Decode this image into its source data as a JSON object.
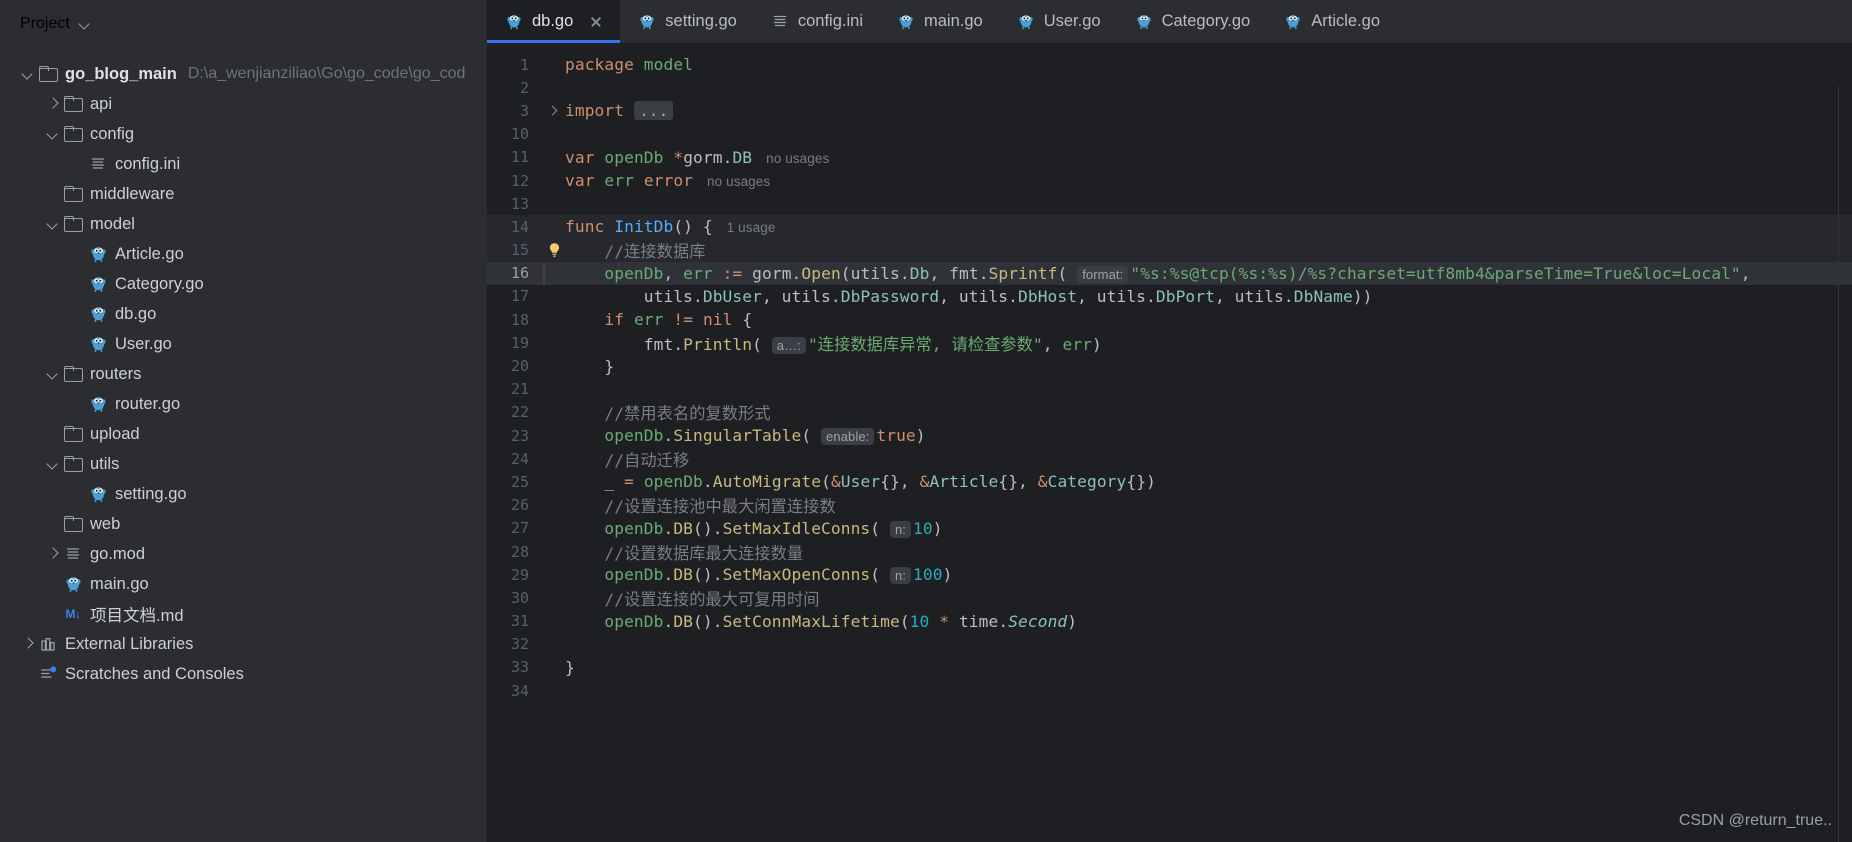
{
  "sidebar": {
    "header": {
      "title": "Project",
      "chevron_icon": "chevron-down-icon"
    },
    "tree": [
      {
        "indent": 0,
        "arrow": "down",
        "icon": "folder-icon",
        "label": "go_blog_main",
        "bold": true,
        "path": "D:\\a_wenjianziliao\\Go\\go_code\\go_cod"
      },
      {
        "indent": 1,
        "arrow": "right",
        "icon": "folder-icon",
        "label": "api"
      },
      {
        "indent": 1,
        "arrow": "down",
        "icon": "folder-icon",
        "label": "config"
      },
      {
        "indent": 2,
        "arrow": "none",
        "icon": "ini-file-icon",
        "label": "config.ini"
      },
      {
        "indent": 1,
        "arrow": "none",
        "icon": "folder-icon",
        "label": "middleware"
      },
      {
        "indent": 1,
        "arrow": "down",
        "icon": "folder-icon",
        "label": "model"
      },
      {
        "indent": 2,
        "arrow": "none",
        "icon": "go-file-icon",
        "label": "Article.go"
      },
      {
        "indent": 2,
        "arrow": "none",
        "icon": "go-file-icon",
        "label": "Category.go"
      },
      {
        "indent": 2,
        "arrow": "none",
        "icon": "go-file-icon",
        "label": "db.go"
      },
      {
        "indent": 2,
        "arrow": "none",
        "icon": "go-file-icon",
        "label": "User.go"
      },
      {
        "indent": 1,
        "arrow": "down",
        "icon": "folder-icon",
        "label": "routers"
      },
      {
        "indent": 2,
        "arrow": "none",
        "icon": "go-file-icon",
        "label": "router.go"
      },
      {
        "indent": 1,
        "arrow": "none",
        "icon": "folder-icon",
        "label": "upload"
      },
      {
        "indent": 1,
        "arrow": "down",
        "icon": "folder-icon",
        "label": "utils"
      },
      {
        "indent": 2,
        "arrow": "none",
        "icon": "go-file-icon",
        "label": "setting.go"
      },
      {
        "indent": 1,
        "arrow": "none",
        "icon": "folder-icon",
        "label": "web"
      },
      {
        "indent": 1,
        "arrow": "right",
        "icon": "modfile-icon",
        "label": "go.mod"
      },
      {
        "indent": 1,
        "arrow": "none",
        "icon": "go-file-icon",
        "label": "main.go"
      },
      {
        "indent": 1,
        "arrow": "none",
        "icon": "markdown-icon",
        "label": "项目文档.md"
      },
      {
        "indent": 0,
        "arrow": "right",
        "icon": "library-icon",
        "label": "External Libraries"
      },
      {
        "indent": 0,
        "arrow": "none",
        "icon": "scratch-icon",
        "label": "Scratches and Consoles"
      }
    ]
  },
  "tabs": [
    {
      "label": "db.go",
      "icon": "go-file-icon",
      "active": true,
      "closable": true
    },
    {
      "label": "setting.go",
      "icon": "go-file-icon",
      "active": false,
      "closable": false
    },
    {
      "label": "config.ini",
      "icon": "ini-file-icon",
      "active": false,
      "closable": false
    },
    {
      "label": "main.go",
      "icon": "go-file-icon",
      "active": false,
      "closable": false
    },
    {
      "label": "User.go",
      "icon": "go-file-icon",
      "active": false,
      "closable": false
    },
    {
      "label": "Category.go",
      "icon": "go-file-icon",
      "active": false,
      "closable": false
    },
    {
      "label": "Article.go",
      "icon": "go-file-icon",
      "active": false,
      "closable": false
    }
  ],
  "editor": {
    "language": "go",
    "line_numbers": [
      1,
      2,
      3,
      10,
      11,
      12,
      13,
      14,
      15,
      16,
      17,
      18,
      19,
      20,
      21,
      22,
      23,
      24,
      25,
      26,
      27,
      28,
      29,
      30,
      31,
      32,
      33,
      34
    ],
    "lines": [
      {
        "n": 1,
        "text": "package model"
      },
      {
        "n": 2,
        "text": ""
      },
      {
        "n": 3,
        "text": "import ...",
        "folded": true
      },
      {
        "n": 10,
        "text": ""
      },
      {
        "n": 11,
        "text": "var openDb *gorm.DB",
        "inlay": "no usages"
      },
      {
        "n": 12,
        "text": "var err error",
        "inlay": "no usages"
      },
      {
        "n": 13,
        "text": ""
      },
      {
        "n": 14,
        "text": "func InitDb() {",
        "inlay": "1 usage",
        "highlight": true
      },
      {
        "n": 15,
        "text": "    //连接数据库",
        "bulb": true,
        "highlight": true
      },
      {
        "n": 16,
        "text": "    openDb, err := gorm.Open(utils.Db, fmt.Sprintf( format: \"%s:%s@tcp(%s:%s)/%s?charset=utf8mb4&parseTime=True&loc=Local\",",
        "selected": true
      },
      {
        "n": 17,
        "text": "        utils.DbUser, utils.DbPassword, utils.DbHost, utils.DbPort, utils.DbName))"
      },
      {
        "n": 18,
        "text": "    if err != nil {"
      },
      {
        "n": 19,
        "text": "        fmt.Println( a…: \"连接数据库异常, 请检查参数\", err)"
      },
      {
        "n": 20,
        "text": "    }"
      },
      {
        "n": 21,
        "text": ""
      },
      {
        "n": 22,
        "text": "    //禁用表名的复数形式"
      },
      {
        "n": 23,
        "text": "    openDb.SingularTable( enable: true)"
      },
      {
        "n": 24,
        "text": "    //自动迁移"
      },
      {
        "n": 25,
        "text": "    _ = openDb.AutoMigrate(&User{}, &Article{}, &Category{})"
      },
      {
        "n": 26,
        "text": "    //设置连接池中最大闲置连接数"
      },
      {
        "n": 27,
        "text": "    openDb.DB().SetMaxIdleConns( n: 10)"
      },
      {
        "n": 28,
        "text": "    //设置数据库最大连接数量"
      },
      {
        "n": 29,
        "text": "    openDb.DB().SetMaxOpenConns( n: 100)"
      },
      {
        "n": 30,
        "text": "    //设置连接的最大可复用时间"
      },
      {
        "n": 31,
        "text": "    openDb.DB().SetConnMaxLifetime(10 * time.Second)"
      },
      {
        "n": 32,
        "text": ""
      },
      {
        "n": 33,
        "text": "}"
      },
      {
        "n": 34,
        "text": ""
      }
    ],
    "code_tokens": {
      "l1": [
        [
          "kw",
          "package"
        ],
        [
          "id",
          " "
        ],
        [
          "var",
          "model"
        ]
      ],
      "l3": [
        [
          "kw",
          "import"
        ],
        [
          "id",
          " "
        ],
        [
          "fold",
          "..."
        ]
      ],
      "l11": [
        [
          "kw",
          "var"
        ],
        [
          "id",
          " "
        ],
        [
          "var_u",
          "openDb"
        ],
        [
          "id",
          " "
        ],
        [
          "kw",
          "*"
        ],
        [
          "typ",
          "gorm"
        ],
        [
          "id",
          "."
        ],
        [
          "typ",
          "DB"
        ]
      ],
      "l12": [
        [
          "kw",
          "var"
        ],
        [
          "id",
          " "
        ],
        [
          "var_u",
          "err"
        ],
        [
          "id",
          " "
        ],
        [
          "kw",
          "error"
        ]
      ],
      "l14": [
        [
          "kw",
          "func"
        ],
        [
          "id",
          " "
        ],
        [
          "fn",
          "InitDb"
        ],
        [
          "id",
          "() {"
        ]
      ],
      "l16_pre": "openDb, err := gorm.Open(utils.Db, fmt.Sprintf(",
      "l16_hint": "format:",
      "l16_str": "\"%s:%s@tcp(%s:%s)/%s?charset=utf8mb4&parseTime=True&loc=Local\"",
      "l17": "utils.DbUser, utils.DbPassword, utils.DbHost, utils.DbPort, utils.DbName))",
      "l19_hint": "a…:",
      "l19_str": "\"连接数据库异常, 请检查参数\"",
      "l23_hint": "enable:",
      "l27_hint": "n:",
      "l27_num": "10",
      "l29_hint": "n:",
      "l29_num": "100",
      "l31_num": "10"
    }
  },
  "watermark": "CSDN @return_true..",
  "colors": {
    "sidebar_bg": "#2b2d30",
    "editor_bg": "#1e1f22",
    "accent": "#3574f0",
    "keyword": "#cf8e6d",
    "string": "#6aab73",
    "number": "#2aacb8",
    "function": "#57aaf7",
    "method": "#c9b880",
    "type": "#8cc2b9",
    "comment": "#7a7e85",
    "text": "#bcbec4",
    "inlay": "#787c82",
    "gopher_blue": "#4a9ed4"
  }
}
